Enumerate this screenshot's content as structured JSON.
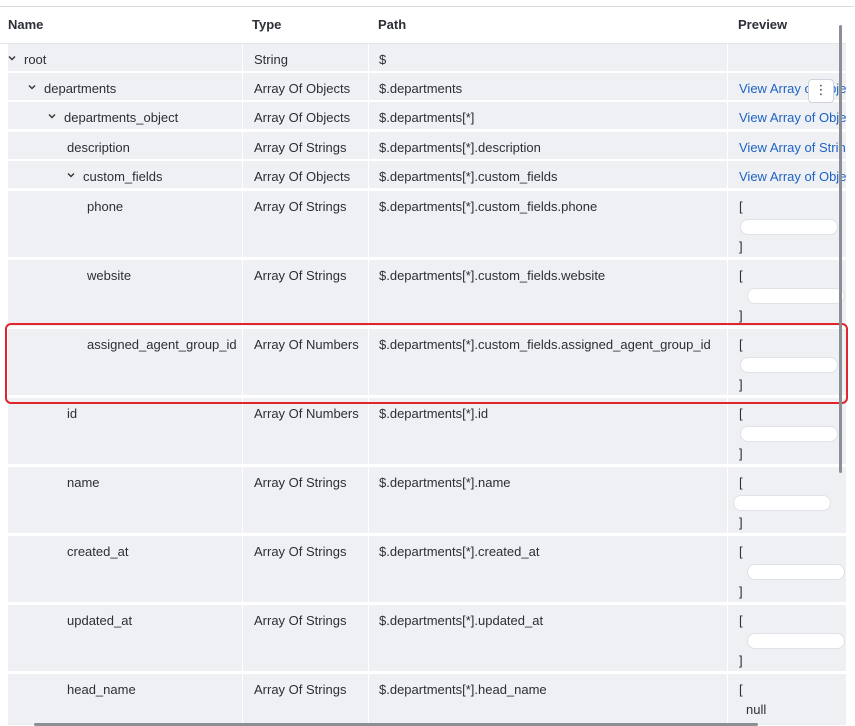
{
  "columns": {
    "name": "Name",
    "type": "Type",
    "path": "Path",
    "preview": "Preview"
  },
  "rows": [
    {
      "name": "root",
      "type": "String",
      "path": "$",
      "preview": ""
    },
    {
      "name": "departments",
      "type": "Array Of Objects",
      "path": "$.departments",
      "preview": "View Array of Objects"
    },
    {
      "name": "departments_object",
      "type": "Array Of Objects",
      "path": "$.departments[*]",
      "preview": "View Array of Objects"
    },
    {
      "name": "description",
      "type": "Array Of Strings",
      "path": "$.departments[*].description",
      "preview": "View Array of Strings"
    },
    {
      "name": "custom_fields",
      "type": "Array Of Objects",
      "path": "$.departments[*].custom_fields",
      "preview": "View Array of Objects"
    },
    {
      "name": "phone",
      "type": "Array Of Strings",
      "path": "$.departments[*].custom_fields.phone",
      "preview_open": "[",
      "preview_close": "]"
    },
    {
      "name": "website",
      "type": "Array Of Strings",
      "path": "$.departments[*].custom_fields.website",
      "preview_open": "[",
      "preview_close": "]"
    },
    {
      "name": "assigned_agent_group_id",
      "type": "Array Of Numbers",
      "path": "$.departments[*].custom_fields.assigned_agent_group_id",
      "preview_open": "[",
      "preview_close": "]"
    },
    {
      "name": "id",
      "type": "Array Of Numbers",
      "path": "$.departments[*].id",
      "preview_open": "[",
      "preview_close": "]"
    },
    {
      "name": "name",
      "type": "Array Of Strings",
      "path": "$.departments[*].name",
      "preview_open": "[",
      "preview_close": "]"
    },
    {
      "name": "created_at",
      "type": "Array Of Strings",
      "path": "$.departments[*].created_at",
      "preview_open": "[",
      "preview_close": "]"
    },
    {
      "name": "updated_at",
      "type": "Array Of Strings",
      "path": "$.departments[*].updated_at",
      "preview_open": "[",
      "preview_close": "]"
    },
    {
      "name": "head_name",
      "type": "Array Of Strings",
      "path": "$.departments[*].head_name",
      "preview_open": "[",
      "preview_value": "null"
    }
  ],
  "row_menu_icon": "⋮",
  "icons": {
    "expand": "chevron-down-icon",
    "menu": "kebab-menu-icon"
  },
  "colors": {
    "link": "#1f63c6",
    "row_bg": "#eef0f3",
    "highlight": "#e0262b"
  }
}
